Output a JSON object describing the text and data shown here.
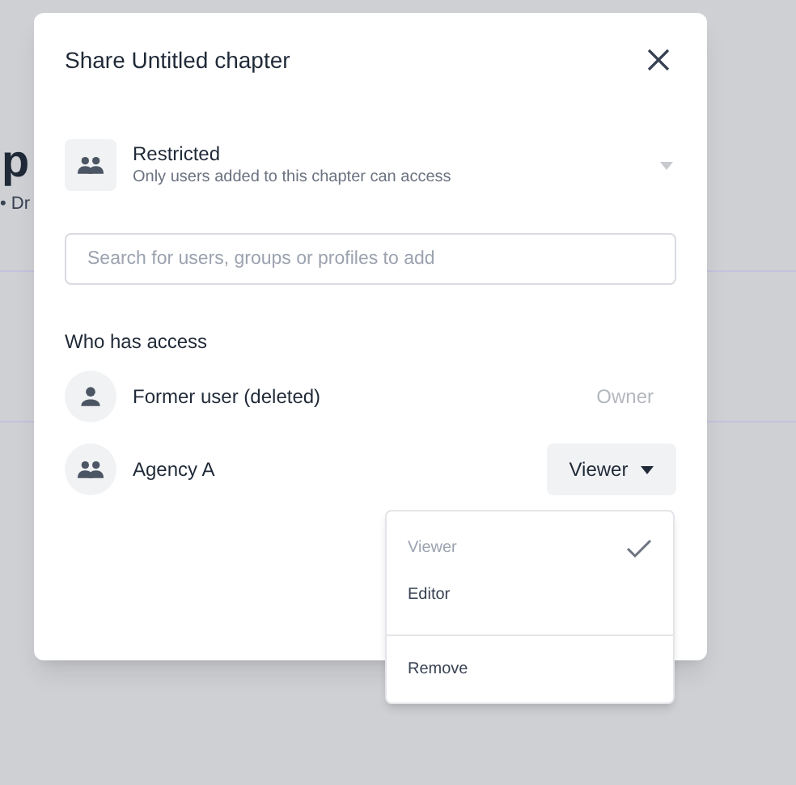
{
  "background": {
    "heading": "p",
    "subtitle": "• Dr"
  },
  "dialog": {
    "title": "Share Untitled chapter",
    "access": {
      "label": "Restricted",
      "description": "Only users added to this chapter can access"
    },
    "search": {
      "placeholder": "Search for users, groups or profiles to add"
    },
    "section_title": "Who has access",
    "members": [
      {
        "kind": "user",
        "name": "Former user (deleted)",
        "role": "Owner",
        "editable": false
      },
      {
        "kind": "group",
        "name": "Agency A",
        "role": "Viewer",
        "editable": true
      }
    ]
  },
  "role_menu": {
    "options": [
      {
        "label": "Viewer",
        "selected": true
      },
      {
        "label": "Editor",
        "selected": false
      }
    ],
    "remove": "Remove"
  }
}
